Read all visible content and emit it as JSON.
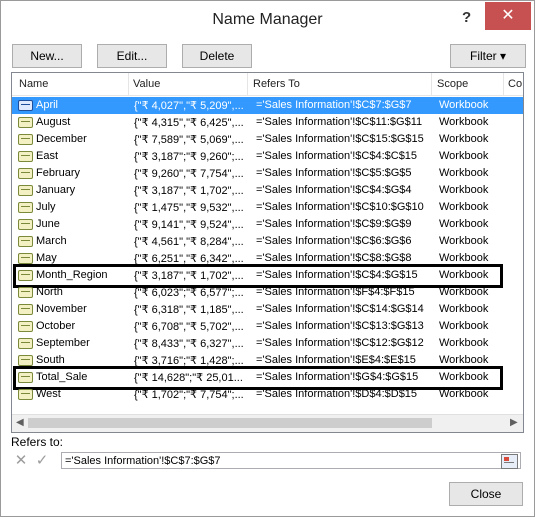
{
  "window": {
    "title": "Name Manager",
    "help": "?",
    "close": "✕"
  },
  "toolbar": {
    "new_label": "New...",
    "edit_label": "Edit...",
    "delete_label": "Delete",
    "filter_label": "Filter ▾"
  },
  "columns": {
    "name": "Name",
    "value": "Value",
    "refers_to": "Refers To",
    "scope": "Scope",
    "comment": "Co"
  },
  "names": [
    {
      "name": "April",
      "value": "{\"₹ 4,027\",\"₹ 5,209\",...",
      "refers_to": "='Sales Information'!$C$7:$G$7",
      "scope": "Workbook"
    },
    {
      "name": "August",
      "value": "{\"₹ 4,315\",\"₹ 6,425\",...",
      "refers_to": "='Sales Information'!$C$11:$G$11",
      "scope": "Workbook"
    },
    {
      "name": "December",
      "value": "{\"₹ 7,589\",\"₹ 5,069\",...",
      "refers_to": "='Sales Information'!$C$15:$G$15",
      "scope": "Workbook"
    },
    {
      "name": "East",
      "value": "{\"₹ 3,187\";\"₹ 9,260\";...",
      "refers_to": "='Sales Information'!$C$4:$C$15",
      "scope": "Workbook"
    },
    {
      "name": "February",
      "value": "{\"₹ 9,260\",\"₹ 7,754\",...",
      "refers_to": "='Sales Information'!$C$5:$G$5",
      "scope": "Workbook"
    },
    {
      "name": "January",
      "value": "{\"₹ 3,187\",\"₹ 1,702\",...",
      "refers_to": "='Sales Information'!$C$4:$G$4",
      "scope": "Workbook"
    },
    {
      "name": "July",
      "value": "{\"₹ 1,475\",\"₹ 9,532\",...",
      "refers_to": "='Sales Information'!$C$10:$G$10",
      "scope": "Workbook"
    },
    {
      "name": "June",
      "value": "{\"₹ 9,141\",\"₹ 9,524\",...",
      "refers_to": "='Sales Information'!$C$9:$G$9",
      "scope": "Workbook"
    },
    {
      "name": "March",
      "value": "{\"₹ 4,561\",\"₹ 8,284\",...",
      "refers_to": "='Sales Information'!$C$6:$G$6",
      "scope": "Workbook"
    },
    {
      "name": "May",
      "value": "{\"₹ 6,251\",\"₹ 6,342\",...",
      "refers_to": "='Sales Information'!$C$8:$G$8",
      "scope": "Workbook"
    },
    {
      "name": "Month_Region",
      "value": "{\"₹ 3,187\",\"₹ 1,702\",...",
      "refers_to": "='Sales Information'!$C$4:$G$15",
      "scope": "Workbook"
    },
    {
      "name": "North",
      "value": "{\"₹ 6,023\";\"₹ 6,577\";...",
      "refers_to": "='Sales Information'!$F$4:$F$15",
      "scope": "Workbook"
    },
    {
      "name": "November",
      "value": "{\"₹ 6,318\",\"₹ 1,185\",...",
      "refers_to": "='Sales Information'!$C$14:$G$14",
      "scope": "Workbook"
    },
    {
      "name": "October",
      "value": "{\"₹ 6,708\",\"₹ 5,702\",...",
      "refers_to": "='Sales Information'!$C$13:$G$13",
      "scope": "Workbook"
    },
    {
      "name": "September",
      "value": "{\"₹ 8,433\",\"₹ 6,327\",...",
      "refers_to": "='Sales Information'!$C$12:$G$12",
      "scope": "Workbook"
    },
    {
      "name": "South",
      "value": "{\"₹ 3,716\";\"₹ 1,428\";...",
      "refers_to": "='Sales Information'!$E$4:$E$15",
      "scope": "Workbook"
    },
    {
      "name": "Total_Sale",
      "value": "{\"₹ 14,628\";\"₹ 25,01...",
      "refers_to": "='Sales Information'!$G$4:$G$15",
      "scope": "Workbook"
    },
    {
      "name": "West",
      "value": "{\"₹ 1,702\";\"₹ 7,754\";...",
      "refers_to": "='Sales Information'!$D$4:$D$15",
      "scope": "Workbook"
    }
  ],
  "selected_name": "April",
  "highlighted_names": [
    "Month_Region",
    "Total_Sale"
  ],
  "refers_to": {
    "label": "Refers to:",
    "value": "='Sales Information'!$C$7:$G$7",
    "cancel": "✕",
    "confirm": "✓"
  },
  "footer": {
    "close_label": "Close"
  },
  "colors": {
    "selection": "#3399ff",
    "close_button": "#c75050"
  }
}
